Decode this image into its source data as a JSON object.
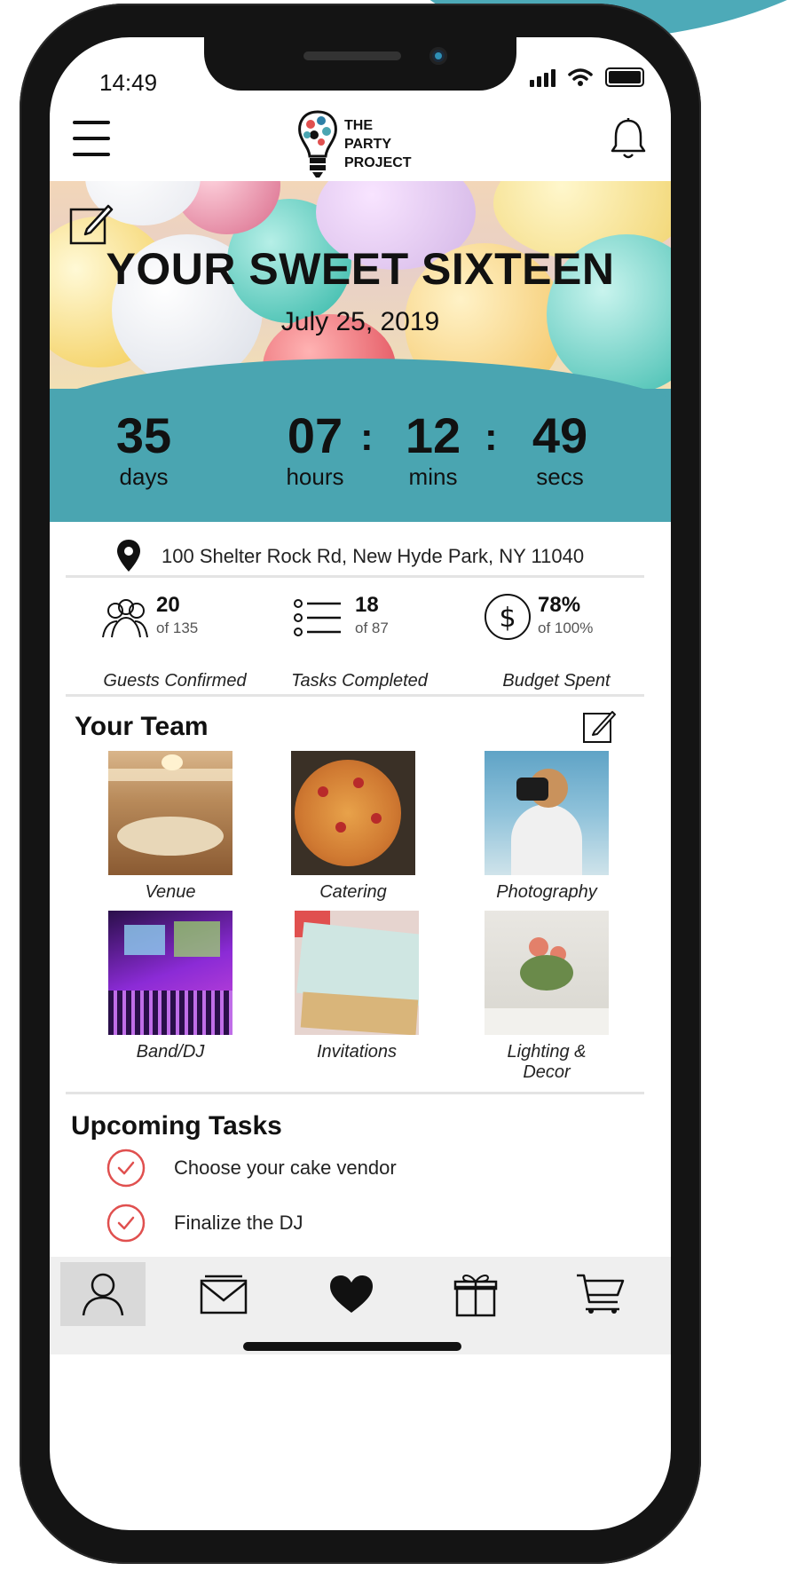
{
  "status_bar": {
    "time": "14:49"
  },
  "app": {
    "logo_lines": [
      "THE",
      "PARTY",
      "PROJECT"
    ]
  },
  "event": {
    "title": "YOUR SWEET SIXTEEN",
    "date": "July 25, 2019"
  },
  "countdown": {
    "days": "35",
    "days_label": "days",
    "hours": "07",
    "hours_label": "hours",
    "mins": "12",
    "mins_label": "mins",
    "secs": "49",
    "secs_label": "secs",
    "separator": ":"
  },
  "address": "100 Shelter Rock Rd, New Hyde Park, NY 11040",
  "stats": {
    "guests": {
      "value": "20",
      "of": "of 135",
      "label": "Guests Confirmed"
    },
    "tasks": {
      "value": "18",
      "of": "of 87",
      "label": "Tasks Completed"
    },
    "budget": {
      "value": "78%",
      "of": "of 100%",
      "label": "Budget Spent"
    }
  },
  "team": {
    "title": "Your Team",
    "items": [
      {
        "label": "Venue"
      },
      {
        "label": "Catering"
      },
      {
        "label": "Photography"
      },
      {
        "label": "Band/DJ"
      },
      {
        "label": "Invitations"
      },
      {
        "label": "Lighting &\nDecor"
      }
    ]
  },
  "upcoming": {
    "title": "Upcoming Tasks",
    "tasks": [
      {
        "text": "Choose your cake vendor"
      },
      {
        "text": "Finalize the DJ"
      }
    ]
  },
  "tabbar": {
    "tabs": [
      {
        "icon": "profile-icon"
      },
      {
        "icon": "mail-icon"
      },
      {
        "icon": "heart-icon"
      },
      {
        "icon": "gift-icon"
      },
      {
        "icon": "cart-icon"
      }
    ],
    "active_index": 0
  },
  "colors": {
    "accent_teal": "#4aa5b1",
    "task_check_red": "#e0504f"
  }
}
